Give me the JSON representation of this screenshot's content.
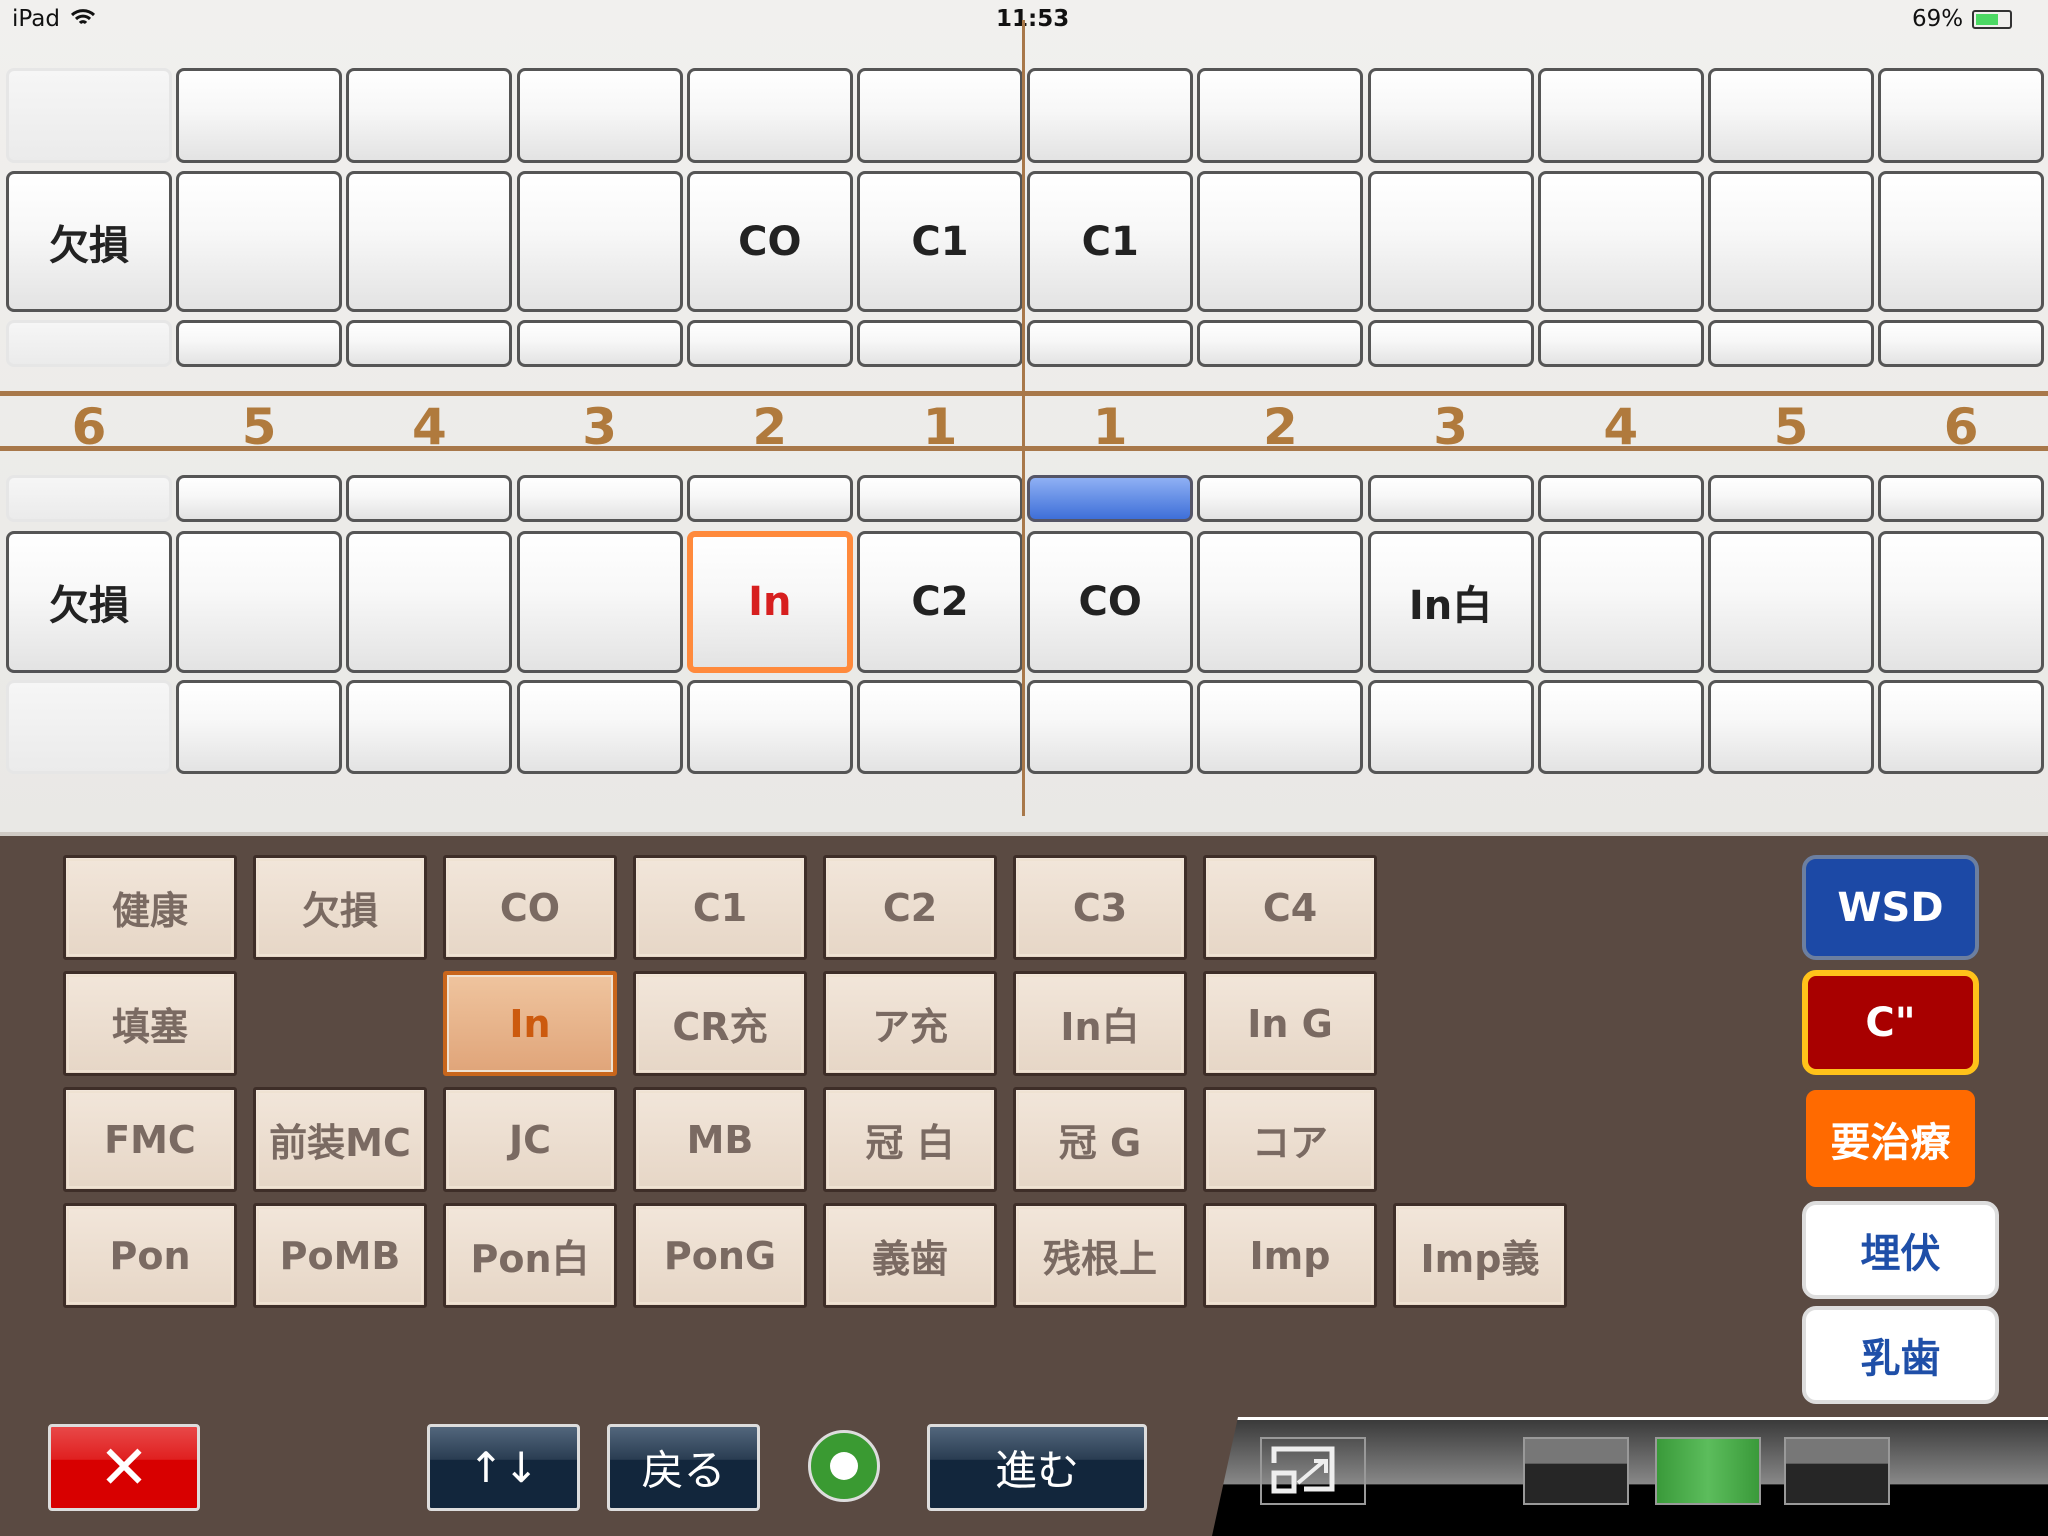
{
  "status_bar": {
    "device": "iPad",
    "time": "11:53",
    "battery": "69%",
    "battery_level": 0.69
  },
  "tooth_numbers": [
    "6",
    "5",
    "4",
    "3",
    "2",
    "1",
    "1",
    "2",
    "3",
    "4",
    "5",
    "6"
  ],
  "upper_labels": [
    "欠損",
    "",
    "",
    "",
    "CO",
    "C1",
    "C1",
    "",
    "",
    "",
    "",
    ""
  ],
  "lower_labels": [
    "欠損",
    "",
    "",
    "",
    "In",
    "C2",
    "CO",
    "",
    "In白",
    "",
    "",
    ""
  ],
  "lower_selected_index": 4,
  "lower_highlight_index": 6,
  "palette": [
    [
      "健康",
      "欠損",
      "CO",
      "C1",
      "C2",
      "C3",
      "C4"
    ],
    [
      "填塞",
      "",
      "In",
      "CR充",
      "ア充",
      "In白",
      "In G"
    ],
    [
      "FMC",
      "前装MC",
      "JC",
      "MB",
      "冠 白",
      "冠 G",
      "コア"
    ],
    [
      "Pon",
      "PoMB",
      "Pon白",
      "PonG",
      "義歯",
      "残根上",
      "Imp",
      "Imp義"
    ]
  ],
  "palette_selected": "In",
  "right_buttons": [
    {
      "label": "WSD",
      "bg": "#1c49a6",
      "color": "#ffffff",
      "border": "#6c7fa0"
    },
    {
      "label": "C\"",
      "bg": "#a80000",
      "color": "#ffffff",
      "border": "#ffc21a"
    },
    {
      "label": "要治療",
      "bg": "#ff6a00",
      "color": "#ffffff",
      "border": "#5a4a42"
    },
    {
      "label": "埋伏",
      "bg": "#ffffff",
      "color": "#1f4fa8",
      "border": "#ddd"
    },
    {
      "label": "乳歯",
      "bg": "#ffffff",
      "color": "#1f4fa8",
      "border": "#ddd"
    }
  ],
  "bottom": {
    "close": "✕",
    "swap": "↑↓",
    "back": "戻る",
    "forward": "進む"
  },
  "view_boxes": [
    {
      "active": false
    },
    {
      "active": true
    },
    {
      "active": false
    }
  ]
}
